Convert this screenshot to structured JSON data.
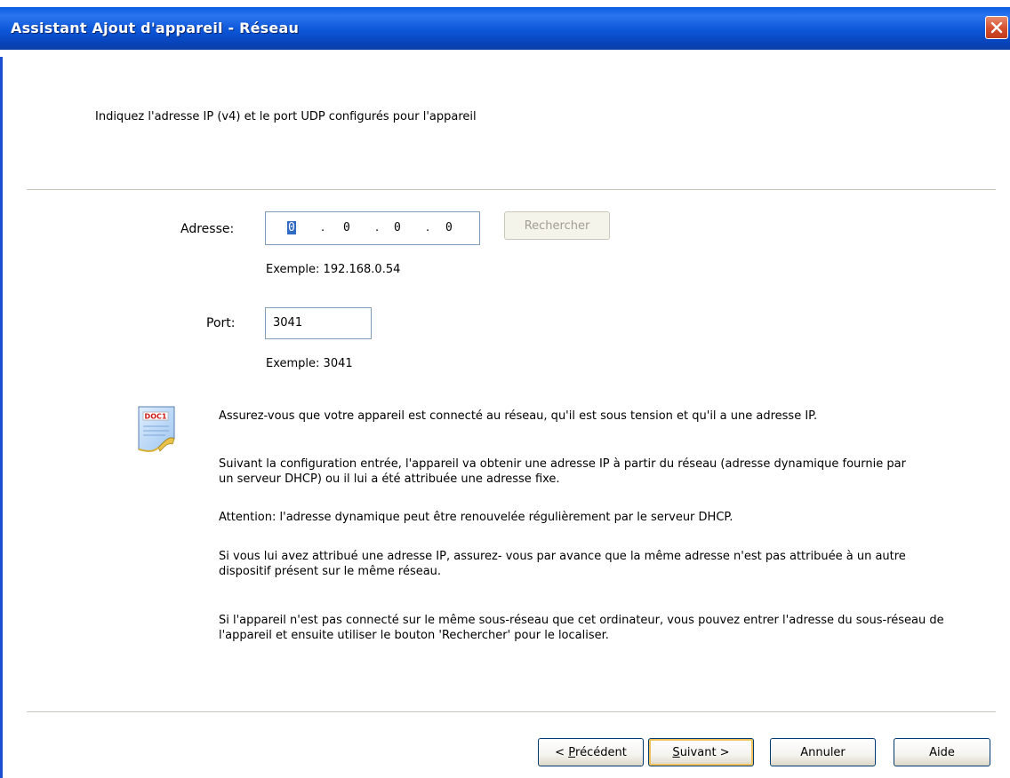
{
  "window": {
    "title": "Assistant Ajout d'appareil - Réseau"
  },
  "header": {
    "instruction": "Indiquez l'adresse IP (v4) et le port UDP configurés pour l'appareil"
  },
  "form": {
    "address_label": "Adresse:",
    "ip_segments": [
      "0",
      "0",
      "0",
      "0"
    ],
    "ip_separator": ".",
    "search_button": "Rechercher",
    "address_example": "Exemple: 192.168.0.54",
    "port_label": "Port:",
    "port_value": "3041",
    "port_example": "Exemple: 3041"
  },
  "info": {
    "icon_name": "document-icon",
    "icon_label": "DOC1",
    "paragraphs": [
      "Assurez-vous que votre appareil est connecté au réseau, qu'il est sous tension et qu'il a une adresse IP.",
      "Suivant la configuration entrée, l'appareil va obtenir une adresse IP à partir du réseau (adresse dynamique fournie par un serveur DHCP) ou il lui a été attribuée une adresse fixe.",
      "Attention: l'adresse dynamique peut être renouvelée régulièrement par le serveur DHCP.",
      "Si vous lui avez attribué une adresse IP, assurez- vous par avance que la même adresse n'est pas attribuée à un autre dispositif présent sur le même réseau.",
      "Si l'appareil n'est pas connecté sur le même sous-réseau que cet ordinateur, vous pouvez entrer l'adresse du sous-réseau de l'appareil et ensuite utiliser le bouton 'Rechercher' pour le localiser."
    ]
  },
  "buttons": {
    "previous_prefix": "< ",
    "previous_mnemonic": "P",
    "previous_rest": "récédent",
    "next_mnemonic": "S",
    "next_rest": "uivant >",
    "cancel": "Annuler",
    "help": "Aide"
  },
  "colors": {
    "titlebar": "#0a56d8",
    "accent_border": "#003c74",
    "default_button_glow": "#f0c05a",
    "selection": "#316ac5"
  }
}
